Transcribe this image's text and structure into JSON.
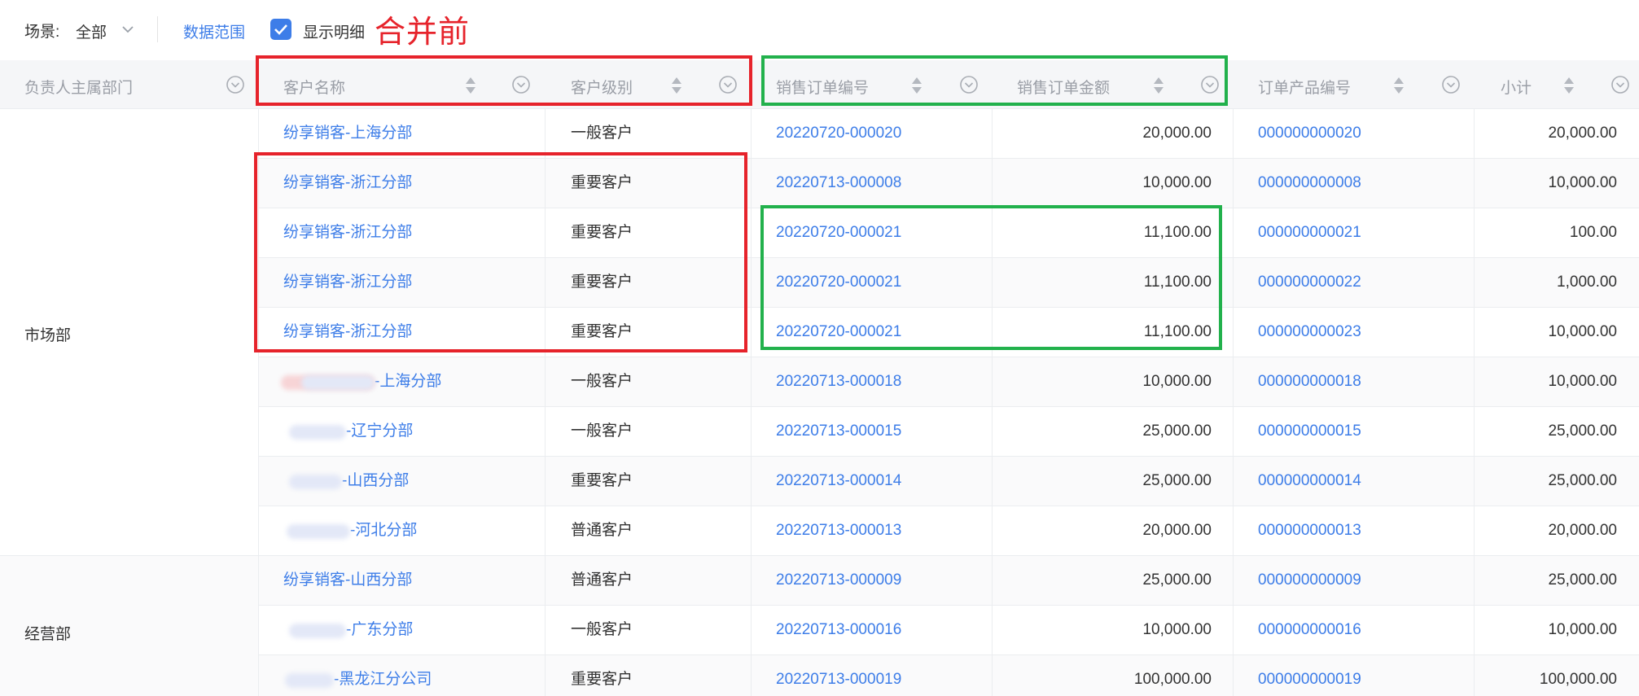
{
  "toolbar": {
    "scene_label": "场景:",
    "scene_value": "全部",
    "data_range_link": "数据范围",
    "show_detail_label": "显示明细",
    "annotation": "合并前"
  },
  "columns": [
    "负责人主属部门",
    "客户名称",
    "客户级别",
    "销售订单编号",
    "销售订单金额",
    "订单产品编号",
    "小计"
  ],
  "departments": [
    "市场部",
    "经营部"
  ],
  "rows": [
    {
      "customer": "纷享销客-上海分部",
      "level": "一般客户",
      "order_no": "20220720-000020",
      "amount": "20,000.00",
      "product_no": "000000000020",
      "subtotal": "20,000.00"
    },
    {
      "customer": "纷享销客-浙江分部",
      "level": "重要客户",
      "order_no": "20220713-000008",
      "amount": "10,000.00",
      "product_no": "000000000008",
      "subtotal": "10,000.00"
    },
    {
      "customer": "纷享销客-浙江分部",
      "level": "重要客户",
      "order_no": "20220720-000021",
      "amount": "11,100.00",
      "product_no": "000000000021",
      "subtotal": "100.00"
    },
    {
      "customer": "纷享销客-浙江分部",
      "level": "重要客户",
      "order_no": "20220720-000021",
      "amount": "11,100.00",
      "product_no": "000000000022",
      "subtotal": "1,000.00"
    },
    {
      "customer": "纷享销客-浙江分部",
      "level": "重要客户",
      "order_no": "20220720-000021",
      "amount": "11,100.00",
      "product_no": "000000000023",
      "subtotal": "10,000.00"
    },
    {
      "customer": "-上海分部",
      "level": "一般客户",
      "order_no": "20220713-000018",
      "amount": "10,000.00",
      "product_no": "000000000018",
      "subtotal": "10,000.00"
    },
    {
      "customer": "-辽宁分部",
      "level": "一般客户",
      "order_no": "20220713-000015",
      "amount": "25,000.00",
      "product_no": "000000000015",
      "subtotal": "25,000.00"
    },
    {
      "customer": "-山西分部",
      "level": "重要客户",
      "order_no": "20220713-000014",
      "amount": "25,000.00",
      "product_no": "000000000014",
      "subtotal": "25,000.00"
    },
    {
      "customer": "-河北分部",
      "level": "普通客户",
      "order_no": "20220713-000013",
      "amount": "20,000.00",
      "product_no": "000000000013",
      "subtotal": "20,000.00"
    },
    {
      "customer": "纷享销客-山西分部",
      "level": "普通客户",
      "order_no": "20220713-000009",
      "amount": "25,000.00",
      "product_no": "000000000009",
      "subtotal": "25,000.00"
    },
    {
      "customer": "-广东分部",
      "level": "一般客户",
      "order_no": "20220713-000016",
      "amount": "10,000.00",
      "product_no": "000000000016",
      "subtotal": "10,000.00"
    },
    {
      "customer": "-黑龙江分公司",
      "level": "重要客户",
      "order_no": "20220713-000019",
      "amount": "100,000.00",
      "product_no": "000000000019",
      "subtotal": "100,000.00"
    }
  ],
  "colors": {
    "link": "#3d7de8",
    "annotation_red": "#e6232b",
    "annotation_green": "#22b14c",
    "header_bg": "#f5f6f8"
  }
}
